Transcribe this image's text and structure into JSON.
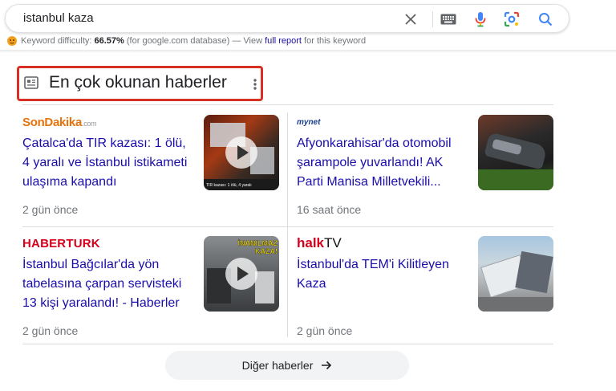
{
  "search": {
    "query": "istanbul kaza"
  },
  "keyword_bar": {
    "label": "Keyword difficulty:",
    "value": "66.57%",
    "db_note": "(for google.com database) — View",
    "link": "full report",
    "suffix": "for this keyword"
  },
  "section": {
    "title": "En çok okunan haberler"
  },
  "articles": [
    {
      "source": "SonDakika",
      "source_suffix": ".com",
      "headline": "Çatalca'da TIR kazası: 1 ölü, 4 yaralı ve İstanbul istikameti ulaşıma kapandı",
      "time": "2 gün önce",
      "thumb_caption": "TIR kazası: 1 ölü, 4 yaralı"
    },
    {
      "source": "mynet",
      "headline": "Afyonkarahisar'da otomobil şarampole yuvarlandı! AK Parti Manisa Milletvekili...",
      "time": "16 saat önce"
    },
    {
      "source": "HABERTURK",
      "headline": "İstanbul Bağcılar'da yön tabelasına çarpan servisteki 13 kişi yaralandı! - Haberler",
      "time": "2 gün önce",
      "thumb_caption": "İNANILMAZ KAZA!"
    },
    {
      "source_a": "halk",
      "source_b": "TV",
      "headline": "İstanbul'da TEM'i Kilitleyen Kaza",
      "time": "2 gün önce"
    }
  ],
  "more_button": {
    "label": "Diğer haberler"
  }
}
